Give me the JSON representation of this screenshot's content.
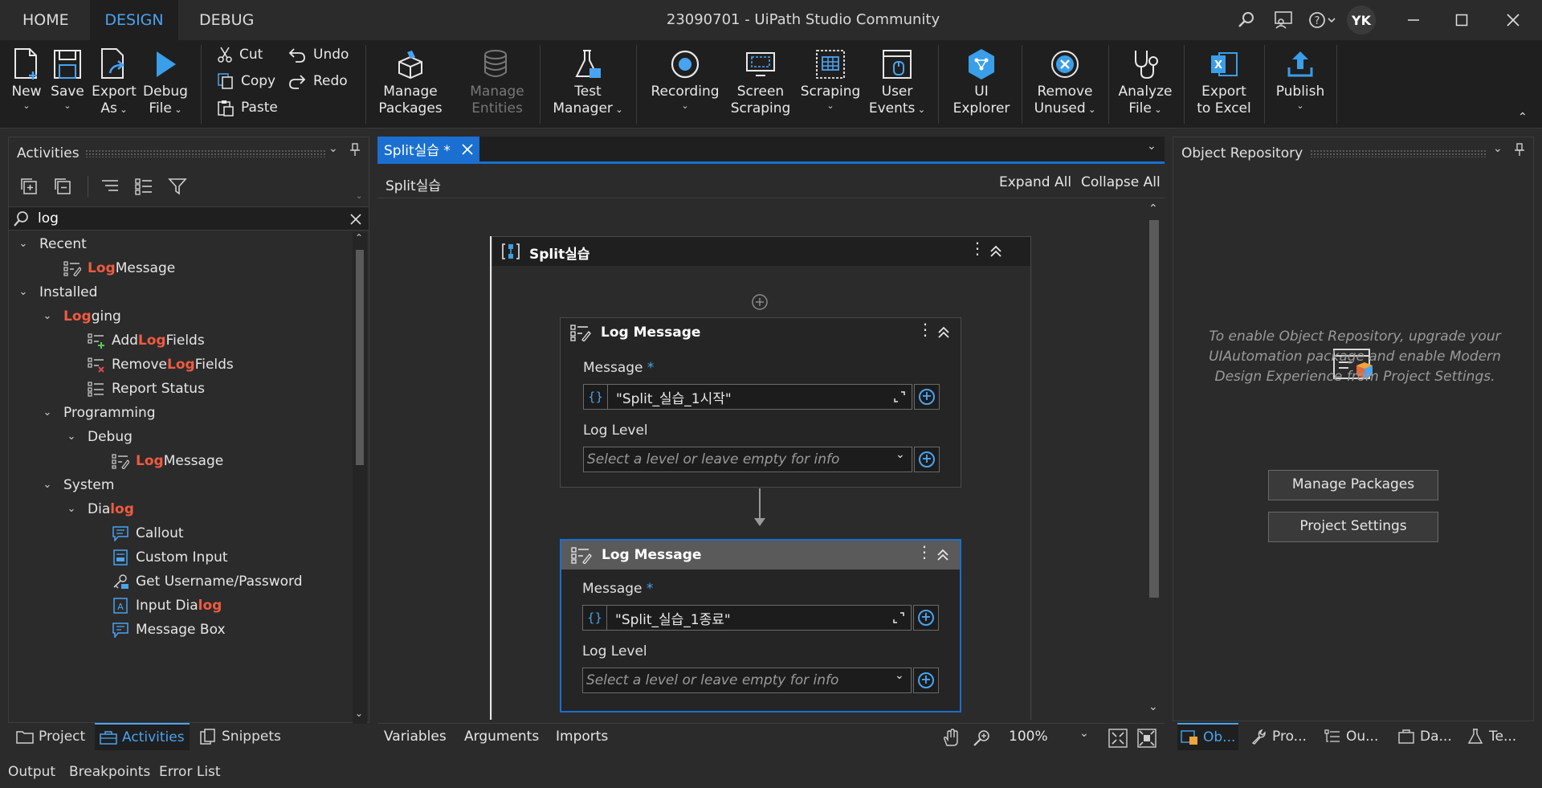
{
  "menu": {
    "home": "HOME",
    "design": "DESIGN",
    "debug": "DEBUG",
    "app_title": "23090701 - UiPath Studio Community",
    "avatar": "YK"
  },
  "ribbon": {
    "new": "New",
    "save": "Save",
    "export_as_1": "Export",
    "export_as_2": "As",
    "debug_file_1": "Debug",
    "debug_file_2": "File",
    "cut": "Cut",
    "copy": "Copy",
    "paste": "Paste",
    "undo": "Undo",
    "redo": "Redo",
    "manage_packages_1": "Manage",
    "manage_packages_2": "Packages",
    "manage_entities_1": "Manage",
    "manage_entities_2": "Entities",
    "test_manager_1": "Test",
    "test_manager_2": "Manager",
    "recording": "Recording",
    "screen_scraping_1": "Screen",
    "screen_scraping_2": "Scraping",
    "scraping": "Scraping",
    "user_events_1": "User",
    "user_events_2": "Events",
    "ui_explorer_1": "UI",
    "ui_explorer_2": "Explorer",
    "remove_unused_1": "Remove",
    "remove_unused_2": "Unused",
    "analyze_file_1": "Analyze",
    "analyze_file_2": "File",
    "export_excel_1": "Export",
    "export_excel_2": "to Excel",
    "publish": "Publish"
  },
  "activities_panel": {
    "title": "Activities",
    "search_value": "log",
    "tree": {
      "recent": "Recent",
      "recent_log_hl": "Log",
      "recent_log_rest": " Message",
      "installed": "Installed",
      "logging_hl": "Log",
      "logging_rest": "ging",
      "add_pre": "Add ",
      "add_hl": "Log",
      "add_post": " Fields",
      "remove_pre": "Remove ",
      "remove_hl": "Log",
      "remove_post": " Fields",
      "report_status": "Report Status",
      "programming": "Programming",
      "debug": "Debug",
      "debug_log_hl": "Log",
      "debug_log_rest": " Message",
      "system": "System",
      "dialog_pre": "Dia",
      "dialog_hl": "log",
      "callout": "Callout",
      "custom_input": "Custom Input",
      "get_username": "Get Username/Password",
      "input_dialog_pre": "Input Dia",
      "input_dialog_hl": "log",
      "message_box": "Message Box"
    },
    "bottom_tabs": {
      "project": "Project",
      "activities": "Activities",
      "snippets": "Snippets"
    }
  },
  "output_tabs": {
    "output": "Output",
    "breakpoints": "Breakpoints",
    "error_list": "Error List"
  },
  "designer": {
    "tab_label": "Split실습 *",
    "breadcrumb": "Split실습",
    "expand_all": "Expand All",
    "collapse_all": "Collapse All",
    "sequence_title": "Split실습",
    "log1": {
      "title": "Log Message",
      "message_label": "Message",
      "required": "*",
      "message_value": "\"Split_실습_1시작\"",
      "level_label": "Log Level",
      "level_placeholder": "Select a level or leave empty for info"
    },
    "log2": {
      "title": "Log Message",
      "message_label": "Message",
      "required": "*",
      "message_value": "\"Split_실습_1종료\"",
      "level_label": "Log Level",
      "level_placeholder": "Select a level or leave empty for info"
    },
    "footer": {
      "variables": "Variables",
      "arguments": "Arguments",
      "imports": "Imports",
      "zoom": "100%"
    }
  },
  "object_repository": {
    "title": "Object Repository",
    "message": "To enable Object Repository, upgrade your UIAutomation package and enable Modern Design Experience from Project Settings.",
    "manage_packages": "Manage Packages",
    "project_settings": "Project Settings",
    "bottom_tabs": {
      "ob": "Ob...",
      "pro": "Pro...",
      "ou": "Ou...",
      "da": "Da...",
      "te": "Te..."
    }
  },
  "colors": {
    "accent": "#4aa3f0",
    "highlight": "#f05a40",
    "selected_border": "#1a6fd0"
  }
}
